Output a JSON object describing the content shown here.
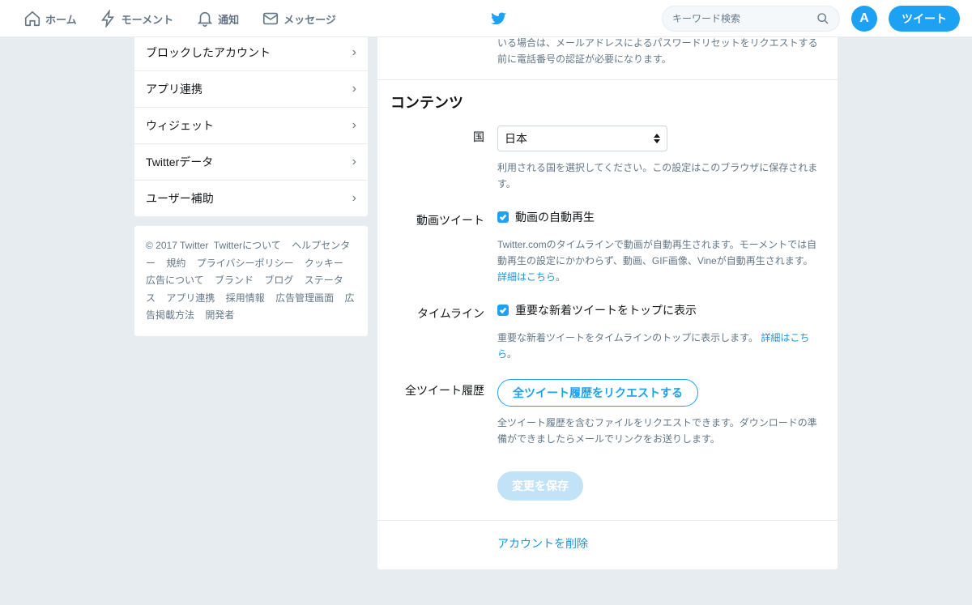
{
  "nav": {
    "home": "ホーム",
    "moments": "モーメント",
    "notifications": "通知",
    "messages": "メッセージ",
    "search_placeholder": "キーワード検索",
    "tweet": "ツイート",
    "avatar_initial": "A"
  },
  "sidebar": {
    "items": [
      "ブロックしたアカウント",
      "アプリ連携",
      "ウィジェット",
      "Twitterデータ",
      "ユーザー補助"
    ]
  },
  "footer": {
    "copyright": "© 2017 Twitter",
    "links": [
      "Twitterについて",
      "ヘルプセンター",
      "規約",
      "プライバシーポリシー",
      "クッキー",
      "広告について",
      "ブランド",
      "ブログ",
      "ステータス",
      "アプリ連携",
      "採用情報",
      "広告管理画面",
      "広告掲載方法",
      "開発者"
    ]
  },
  "settings": {
    "top_hint": "いる場合は、メールアドレスによるパスワードリセットをリクエストする前に電話番号の認証が必要になります。",
    "section_title": "コンテンツ",
    "country": {
      "label": "国",
      "value": "日本",
      "help": "利用される国を選択してください。この設定はこのブラウザに保存されます。"
    },
    "video": {
      "label": "動画ツイート",
      "checkbox": "動画の自動再生",
      "help": "Twitter.comのタイムラインで動画が自動再生されます。モーメントでは自動再生の設定にかかわらず、動画、GIF画像、Vineが自動再生されます。",
      "link": "詳細はこちら"
    },
    "timeline": {
      "label": "タイムライン",
      "checkbox": "重要な新着ツイートをトップに表示",
      "help": "重要な新着ツイートをタイムラインのトップに表示します。",
      "link": "詳細はこちら"
    },
    "archive": {
      "label": "全ツイート履歴",
      "button": "全ツイート履歴をリクエストする",
      "help": "全ツイート履歴を含むファイルをリクエストできます。ダウンロードの準備ができましたらメールでリンクをお送りします。"
    },
    "save": "変更を保存",
    "deactivate": "アカウントを削除"
  }
}
